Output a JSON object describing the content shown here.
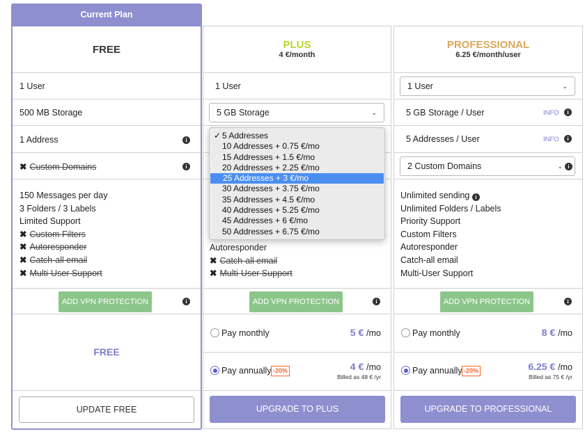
{
  "free": {
    "current_plan_label": "Current Plan",
    "name": "FREE",
    "users": "1 User",
    "storage": "500 MB Storage",
    "addresses": "1 Address",
    "custom_domains": "Custom Domains",
    "features": [
      {
        "text": "150 Messages per day",
        "strike": false
      },
      {
        "text": "3 Folders / 3 Labels",
        "strike": false
      },
      {
        "text": "Limited Support",
        "strike": false
      },
      {
        "text": "Custom Filters",
        "strike": true
      },
      {
        "text": "Autoresponder",
        "strike": true
      },
      {
        "text": "Catch-all email",
        "strike": true
      },
      {
        "text": "Multi-User Support",
        "strike": true
      }
    ],
    "vpn_button": "ADD VPN PROTECTION",
    "price_label": "FREE",
    "action_button": "UPDATE FREE"
  },
  "plus": {
    "name": "PLUS",
    "price_line": "4 €/month",
    "users": "1 User",
    "storage_select": "5 GB Storage",
    "addresses_options": [
      {
        "label": "5 Addresses",
        "checked": true,
        "highlight": false
      },
      {
        "label": "10 Addresses + 0.75 €/mo",
        "checked": false,
        "highlight": false
      },
      {
        "label": "15 Addresses + 1.5 €/mo",
        "checked": false,
        "highlight": false
      },
      {
        "label": "20 Addresses + 2.25 €/mo",
        "checked": false,
        "highlight": false
      },
      {
        "label": "25 Addresses + 3 €/mo",
        "checked": false,
        "highlight": true
      },
      {
        "label": "30 Addresses + 3.75 €/mo",
        "checked": false,
        "highlight": false
      },
      {
        "label": "35 Addresses + 4.5 €/mo",
        "checked": false,
        "highlight": false
      },
      {
        "label": "40 Addresses + 5.25 €/mo",
        "checked": false,
        "highlight": false
      },
      {
        "label": "45 Addresses + 6 €/mo",
        "checked": false,
        "highlight": false
      },
      {
        "label": "50 Addresses + 6.75 €/mo",
        "checked": false,
        "highlight": false
      }
    ],
    "features_visible": [
      {
        "text": "Autoresponder",
        "strike": false
      },
      {
        "text": "Catch-all email",
        "strike": true
      },
      {
        "text": "Multi-User Support",
        "strike": true
      }
    ],
    "vpn_button": "ADD VPN PROTECTION",
    "pay_monthly": "Pay monthly",
    "monthly_price": "5 €",
    "per_mo": "/mo",
    "pay_annually": "Pay annually",
    "discount": "-20%",
    "annual_price": "4 €",
    "billed": "Billed as 48 € /yr",
    "action_button": "UPGRADE TO PLUS"
  },
  "professional": {
    "name": "PROFESSIONAL",
    "price_line": "6.25 €/month/user",
    "users_select": "1 User",
    "storage": "5 GB Storage / User",
    "info_label": "INFO",
    "addresses": "5 Addresses / User",
    "domains_select": "2 Custom Domains",
    "features": [
      {
        "text": "Unlimited sending",
        "info": true
      },
      {
        "text": "Unlimited Folders / Labels",
        "info": false
      },
      {
        "text": "Priority Support",
        "info": false
      },
      {
        "text": "Custom Filters",
        "info": false
      },
      {
        "text": "Autoresponder",
        "info": false
      },
      {
        "text": "Catch-all email",
        "info": false
      },
      {
        "text": "Multi-User Support",
        "info": false
      }
    ],
    "vpn_button": "ADD VPN PROTECTION",
    "pay_monthly": "Pay monthly",
    "monthly_price": "8 €",
    "per_mo": "/mo",
    "pay_annually": "Pay annually",
    "discount": "-20%",
    "annual_price": "6.25 €",
    "billed": "Billed as 75 € /yr",
    "action_button": "UPGRADE TO PROFESSIONAL"
  },
  "colors": {
    "accent": "#8e8fcf",
    "plus_name": "#b6d62a",
    "professional_name": "#d9a85a",
    "vpn_green": "#8cc68a",
    "discount": "#ef6a2d",
    "highlight": "#4b8ef0"
  },
  "icons": {
    "info": "info-circle-icon",
    "cross": "x-mark-icon",
    "chevron": "chevron-down-icon",
    "check": "checkmark-icon"
  }
}
